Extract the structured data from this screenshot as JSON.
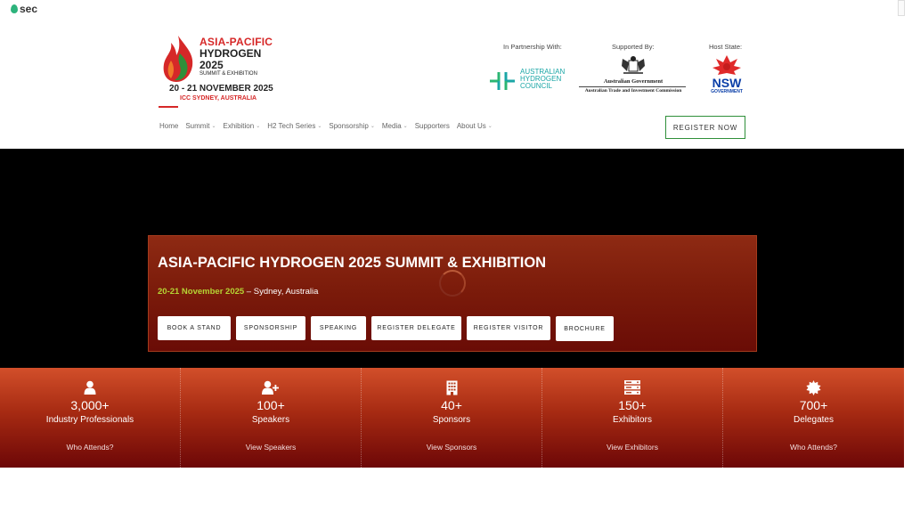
{
  "brand": {
    "sec_label": "sec"
  },
  "logo": {
    "line1": "ASIA-PACIFIC",
    "line2": "HYDROGEN",
    "line3": "2025",
    "line4": "SUMMIT & EXHIBITION",
    "dates": "20 - 21 NOVEMBER 2025",
    "venue": "ICC SYDNEY, AUSTRALIA"
  },
  "partners": {
    "partnership_label": "In Partnership With:",
    "supported_label": "Supported By:",
    "host_label": "Host State:",
    "ahc_lines": [
      "AUSTRALIAN",
      "HYDROGEN",
      "COUNCIL"
    ],
    "gov_line1": "Australian Government",
    "gov_line2": "Australian Trade and Investment Commission",
    "nsw_line1": "NSW",
    "nsw_line2": "GOVERNMENT"
  },
  "nav": {
    "items": [
      {
        "label": "Home",
        "dropdown": false
      },
      {
        "label": "Summit",
        "dropdown": true
      },
      {
        "label": "Exhibition",
        "dropdown": true
      },
      {
        "label": "H2 Tech Series",
        "dropdown": true
      },
      {
        "label": "Sponsorship",
        "dropdown": true
      },
      {
        "label": "Media",
        "dropdown": true
      },
      {
        "label": "Supporters",
        "dropdown": false
      },
      {
        "label": "About Us",
        "dropdown": true
      }
    ],
    "register_label": "REGISTER NOW"
  },
  "hero": {
    "title": "ASIA-PACIFIC HYDROGEN 2025 SUMMIT & EXHIBITION",
    "date": "20-21 November 2025",
    "location": " – Sydney, Australia",
    "buttons": [
      "BOOK A STAND",
      "SPONSORSHIP",
      "SPEAKING",
      "REGISTER DELEGATE",
      "REGISTER VISITOR",
      "BROCHURE"
    ]
  },
  "stats": [
    {
      "icon": "user-icon",
      "number": "3,000+",
      "label": "Industry Professionals",
      "link": "Who Attends?"
    },
    {
      "icon": "add-user-icon",
      "number": "100+",
      "label": "Speakers",
      "link": "View Speakers"
    },
    {
      "icon": "building-icon",
      "number": "40+",
      "label": "Sponsors",
      "link": "View Sponsors"
    },
    {
      "icon": "server-icon",
      "number": "150+",
      "label": "Exhibitors",
      "link": "View Exhibitors"
    },
    {
      "icon": "badge-icon",
      "number": "700+",
      "label": "Delegates",
      "link": "Who Attends?"
    }
  ],
  "colors": {
    "accent_red": "#d62828",
    "accent_green": "#b5d334",
    "register_border": "#2f8f3a",
    "banner_bg": "#7c1c0b"
  }
}
